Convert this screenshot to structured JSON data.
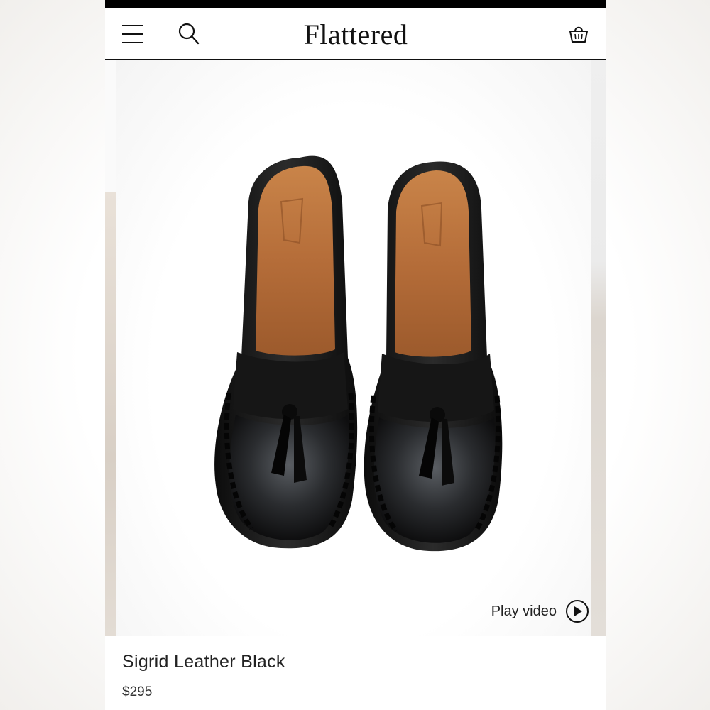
{
  "header": {
    "brand": "Flattered",
    "icons": [
      "menu-icon",
      "search-icon",
      "basket-icon"
    ]
  },
  "media": {
    "play_label": "Play video",
    "play_icon": "play-circle-icon"
  },
  "product": {
    "name": "Sigrid Leather Black",
    "price": "$295"
  },
  "colors": {
    "accent": "#111111",
    "leather": "#1b1b1b",
    "lining": "#b8733f"
  }
}
